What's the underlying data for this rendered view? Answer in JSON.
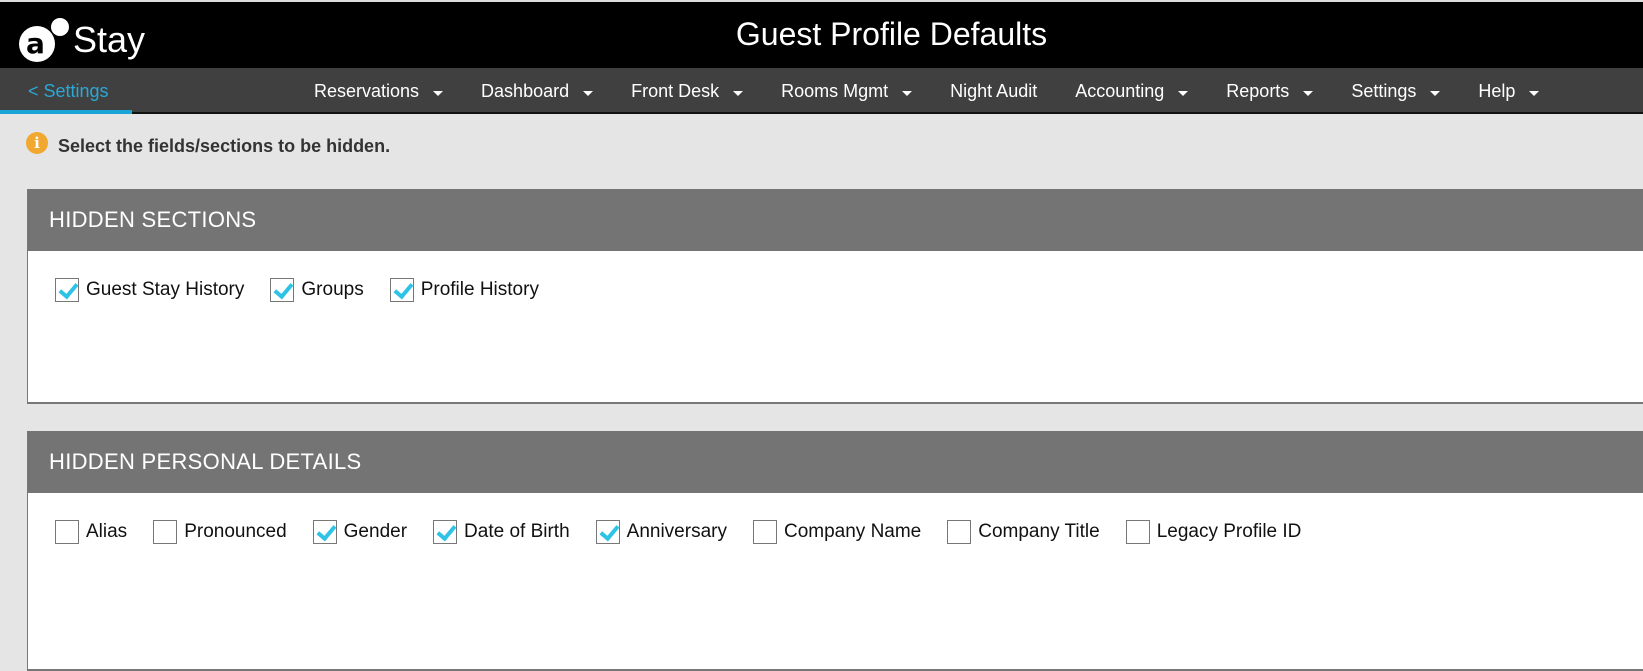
{
  "header": {
    "logo_text": "Stay",
    "logo_mark": "a",
    "title": "Guest Profile Defaults"
  },
  "nav": {
    "back_label": "< Settings",
    "items": [
      {
        "label": "Reservations",
        "dropdown": true
      },
      {
        "label": "Dashboard",
        "dropdown": true
      },
      {
        "label": "Front Desk",
        "dropdown": true
      },
      {
        "label": "Rooms Mgmt",
        "dropdown": true
      },
      {
        "label": "Night Audit",
        "dropdown": false
      },
      {
        "label": "Accounting",
        "dropdown": true
      },
      {
        "label": "Reports",
        "dropdown": true
      },
      {
        "label": "Settings",
        "dropdown": true
      },
      {
        "label": "Help",
        "dropdown": true
      }
    ]
  },
  "info": {
    "icon": "info-icon",
    "text": "Select the fields/sections to be hidden."
  },
  "sections": [
    {
      "title": "HIDDEN SECTIONS",
      "options": [
        {
          "label": "Guest Stay History",
          "checked": true
        },
        {
          "label": "Groups",
          "checked": true
        },
        {
          "label": "Profile History",
          "checked": true
        }
      ]
    },
    {
      "title": "HIDDEN PERSONAL DETAILS",
      "options": [
        {
          "label": "Alias",
          "checked": false
        },
        {
          "label": "Pronounced",
          "checked": false
        },
        {
          "label": "Gender",
          "checked": true
        },
        {
          "label": "Date of Birth",
          "checked": true
        },
        {
          "label": "Anniversary",
          "checked": true
        },
        {
          "label": "Company Name",
          "checked": false
        },
        {
          "label": "Company Title",
          "checked": false
        },
        {
          "label": "Legacy Profile ID",
          "checked": false
        }
      ]
    }
  ],
  "colors": {
    "accent": "#1ba4d6",
    "check": "#2ec3e6",
    "info": "#f0a830",
    "section_header": "#747474",
    "nav_bg": "#404040"
  }
}
